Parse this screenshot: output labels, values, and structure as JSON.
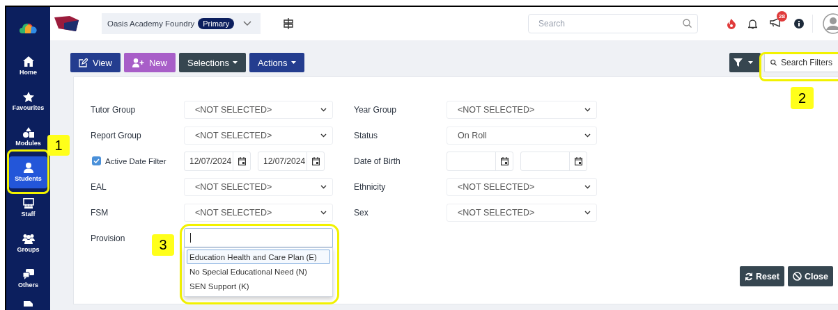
{
  "top_bar": {
    "school": "Oasis Academy Foundry",
    "phase": "Primary",
    "search": {
      "placeholder": "Search"
    },
    "notification_count": "28"
  },
  "sidebar": {
    "items": [
      {
        "label": "Home",
        "kind": "home",
        "selected": false
      },
      {
        "label": "Favourites",
        "kind": "star",
        "selected": false
      },
      {
        "label": "Modules",
        "kind": "modules",
        "selected": false
      },
      {
        "label": "Students",
        "kind": "person",
        "selected": true
      },
      {
        "label": "Staff",
        "kind": "staff",
        "selected": false
      },
      {
        "label": "Groups",
        "kind": "groups",
        "selected": false
      },
      {
        "label": "Others",
        "kind": "others",
        "selected": false
      }
    ]
  },
  "toolbar": {
    "buttons": [
      {
        "label": "View",
        "kind": "edit",
        "color": "#243d8f"
      },
      {
        "label": "New",
        "kind": "add",
        "color": "#a85ec8"
      },
      {
        "label": "Selections",
        "kind": "menu",
        "color": "#364650"
      },
      {
        "label": "Actions",
        "kind": "menu",
        "color": "#243d8f"
      }
    ],
    "search_filters": "Search Filters"
  },
  "filters": {
    "left": [
      {
        "label": "Tutor Group",
        "kind": "select",
        "value": "<NOT SELECTED>"
      },
      {
        "label": "Report Group",
        "kind": "select",
        "value": "<NOT SELECTED>"
      },
      {
        "label": "Active Date Filter",
        "kind": "dates",
        "checked": true,
        "from": "12/07/2024",
        "to": "12/07/2024"
      },
      {
        "label": "EAL",
        "kind": "select",
        "value": "<NOT SELECTED>"
      },
      {
        "label": "FSM",
        "kind": "select",
        "value": "<NOT SELECTED>"
      },
      {
        "label": "Provision",
        "kind": "combo",
        "options": [
          {
            "label": "Education Health and Care Plan (E)",
            "selected": true
          },
          {
            "label": "No Special Educational Need (N)",
            "selected": false
          },
          {
            "label": "SEN Support (K)",
            "selected": false
          }
        ]
      }
    ],
    "right": [
      {
        "label": "Year Group",
        "kind": "select",
        "value": "<NOT SELECTED>"
      },
      {
        "label": "Status",
        "kind": "select",
        "value": "On Roll"
      },
      {
        "label": "Date of Birth",
        "kind": "dates"
      },
      {
        "label": "Ethnicity",
        "kind": "select",
        "value": "<NOT SELECTED>"
      },
      {
        "label": "Sex",
        "kind": "select",
        "value": "<NOT SELECTED>"
      }
    ]
  },
  "panel_buttons": [
    {
      "label": "Reset",
      "kind": "reset"
    },
    {
      "label": "Close",
      "kind": "close"
    }
  ],
  "annotations": [
    {
      "label": "1"
    },
    {
      "label": "2"
    },
    {
      "label": "3"
    }
  ]
}
